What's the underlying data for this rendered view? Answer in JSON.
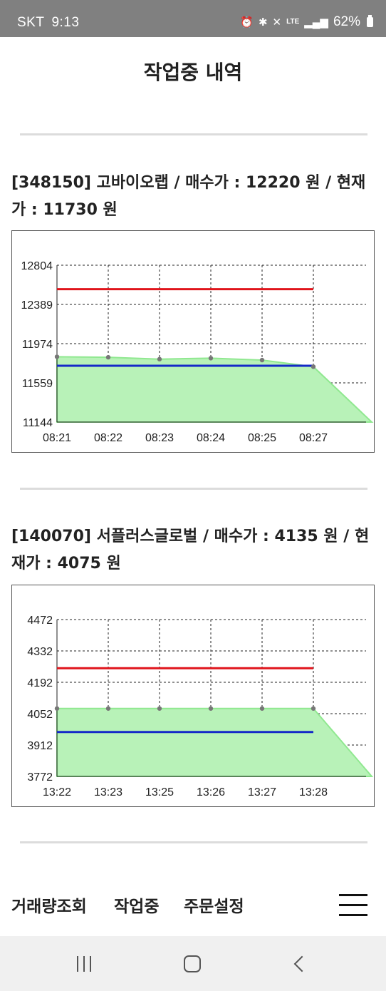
{
  "status": {
    "carrier": "SKT",
    "time": "9:13",
    "battery": "62%",
    "icons": [
      "alarm-icon",
      "bluetooth-icon",
      "mute-icon",
      "lte-icon",
      "signal-icon",
      "battery-icon"
    ]
  },
  "page": {
    "title": "작업중 내역"
  },
  "stocks": [
    {
      "title": "[348150] 고바이오랩 / 매수가 : 12220 원 / 현재가 : 11730 원"
    },
    {
      "title": "[140070] 서플러스글로벌 / 매수가 : 4135 원 / 현재가 : 4075 원"
    }
  ],
  "chart_data": [
    {
      "type": "area",
      "x": [
        "08:21",
        "08:22",
        "08:23",
        "08:24",
        "08:25",
        "08:27"
      ],
      "yticks": [
        12804,
        12389,
        11974,
        11559,
        11144
      ],
      "ylim": [
        11144,
        12804
      ],
      "series": [
        {
          "values": [
            11835,
            11830,
            11810,
            11820,
            11800,
            11730
          ],
          "color": "#90e890"
        },
        {
          "values": [
            12550,
            12550,
            12550,
            12550,
            12550,
            12550
          ],
          "color": "#e0141b"
        },
        {
          "values": [
            11740,
            11740,
            11740,
            11740,
            11740,
            11740
          ],
          "color": "#1428c8"
        }
      ],
      "grid": true
    },
    {
      "type": "area",
      "x": [
        "13:22",
        "13:23",
        "13:25",
        "13:26",
        "13:27",
        "13:28"
      ],
      "yticks": [
        4472,
        4332,
        4192,
        4052,
        3912,
        3772
      ],
      "ylim": [
        3772,
        4472
      ],
      "series": [
        {
          "values": [
            4075,
            4075,
            4075,
            4075,
            4075,
            4075
          ],
          "color": "#90e890"
        },
        {
          "values": [
            4255,
            4255,
            4255,
            4255,
            4255,
            4255
          ],
          "color": "#e0141b"
        },
        {
          "values": [
            3970,
            3970,
            3970,
            3970,
            3970,
            3970
          ],
          "color": "#1428c8"
        }
      ],
      "grid": true
    }
  ],
  "nav": {
    "items": [
      "거래량조회",
      "작업중",
      "주문설정"
    ],
    "menu_icon": "hamburger-icon"
  },
  "system_nav": {
    "icons": [
      "recents-icon",
      "home-icon",
      "back-icon"
    ]
  }
}
